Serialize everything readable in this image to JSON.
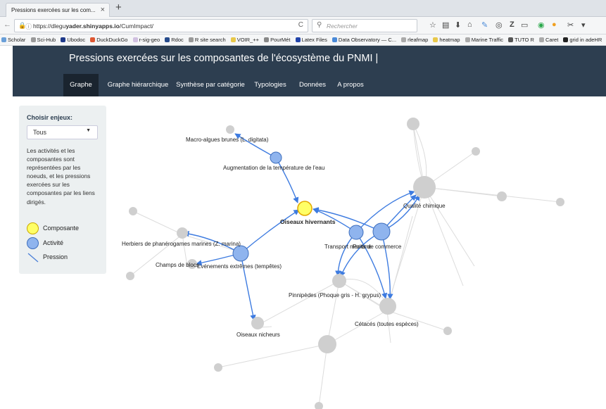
{
  "browser": {
    "tab_title": "Pressions exercées sur les com...",
    "url_prefix": "https://dlegu",
    "url_domain": "yader.shinyapps.io",
    "url_path": "/CumImpact/",
    "search_placeholder": "Rechercher"
  },
  "bookmarks": [
    {
      "label": "Scholar",
      "color": "#6a9fd8"
    },
    {
      "label": "Sci-Hub",
      "color": "#9a9a9a"
    },
    {
      "label": "Ubodoc",
      "color": "#1f3a8a"
    },
    {
      "label": "DuckDuckGo",
      "color": "#de5833"
    },
    {
      "label": "r-sig-geo",
      "color": "#d0c0e0"
    },
    {
      "label": "Rdoc",
      "color": "#264b8c"
    },
    {
      "label": "R site search",
      "color": "#999999"
    },
    {
      "label": "VOIR_++",
      "color": "#e8c84a"
    },
    {
      "label": "PourMét",
      "color": "#888888"
    },
    {
      "label": "Latex Files",
      "color": "#2244aa"
    },
    {
      "label": "Data Observatory — C...",
      "color": "#4a8ad8"
    },
    {
      "label": "rleafmap",
      "color": "#aaaaaa"
    },
    {
      "label": "heatmap",
      "color": "#e8c84a"
    },
    {
      "label": "Marine Traffic",
      "color": "#aaaaaa"
    },
    {
      "label": "TUTO R",
      "color": "#555555"
    },
    {
      "label": "Caret",
      "color": "#aaaaaa"
    },
    {
      "label": "grid in adeHR",
      "color": "#222222"
    }
  ],
  "header": {
    "title": "Pressions exercées sur les composantes de l'écosystème du PNMI |",
    "tabs": [
      {
        "label": "Graphe"
      },
      {
        "label": "Graphe hiérarchique"
      },
      {
        "label": "Synthèse par catégorie"
      },
      {
        "label": "Typologies"
      },
      {
        "label": "Données"
      },
      {
        "label": "A propos"
      }
    ]
  },
  "sidebar": {
    "select_label": "Choisir enjeux:",
    "select_value": "Tous",
    "description": "Les activités et les composantes sont représentées par les noeuds, et les pressions exercées sur les composantes par les liens dirigés.",
    "legend": [
      {
        "label": "Composante",
        "color": "#ffff66"
      },
      {
        "label": "Activité",
        "color": "#8fb4ee"
      },
      {
        "label": "Pression",
        "color": "#4a7fd8"
      }
    ]
  },
  "graph": {
    "node_labels": {
      "macro": "Macro-algues brunes (L. digitata)",
      "temperature": "Augmentation de la température de l'eau",
      "oiseaux_hiv": "Oiseaux hivernants",
      "transport": "Transport maritime",
      "ports": "Ports de commerce",
      "qualite": "Qualité chimique",
      "herbiers": "Herbiers de phanérogames marines (Z. marina)",
      "champs": "Champs de blocs",
      "extremes": "Evénements extrêmes (tempêtes)",
      "pinnipedes": "Pinnipèdes (Phoque gris - H. grypus)",
      "cetaces": "Cétacés (toutes espèces)",
      "oiseaux_nic": "Oiseaux nicheurs"
    }
  }
}
